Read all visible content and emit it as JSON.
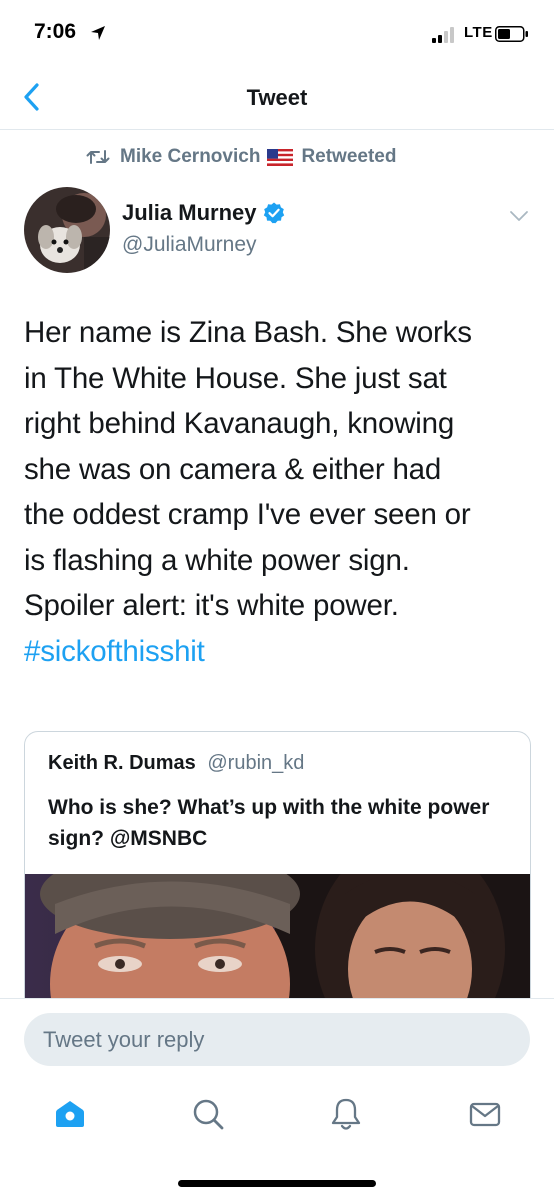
{
  "status_bar": {
    "time": "7:06",
    "network": "LTE"
  },
  "nav": {
    "title": "Tweet",
    "back_icon": "chevron-left-icon"
  },
  "retweet": {
    "user": "Mike Cernovich",
    "label": "Retweeted",
    "icon": "retweet-icon"
  },
  "tweet": {
    "author_name": "Julia Murney",
    "author_handle": "@JuliaMurney",
    "verified": true,
    "text_lines": [
      "Her name is Zina Bash. She works",
      "in The White House. She just sat",
      "right behind Kavanaugh, knowing",
      "she was on camera & either had",
      "the oddest cramp I've ever seen or",
      "is flashing a white power sign.",
      "Spoiler alert: it's white power."
    ],
    "hashtag": "#sickofthisshit"
  },
  "quote": {
    "author_name": "Keith R. Dumas",
    "author_handle": "@rubin_kd",
    "text": "Who is she? What’s up with the white power sign? @MSNBC"
  },
  "reply": {
    "placeholder": "Tweet your reply"
  },
  "tabs": [
    {
      "icon": "home-icon",
      "active": true
    },
    {
      "icon": "search-icon",
      "active": false
    },
    {
      "icon": "notifications-bell-icon",
      "active": false
    },
    {
      "icon": "messages-envelope-icon",
      "active": false
    }
  ],
  "colors": {
    "accent": "#1da1f2",
    "secondary_text": "#657786",
    "reply_field_bg": "#e6ecf0",
    "divider": "#e1e8ed"
  }
}
